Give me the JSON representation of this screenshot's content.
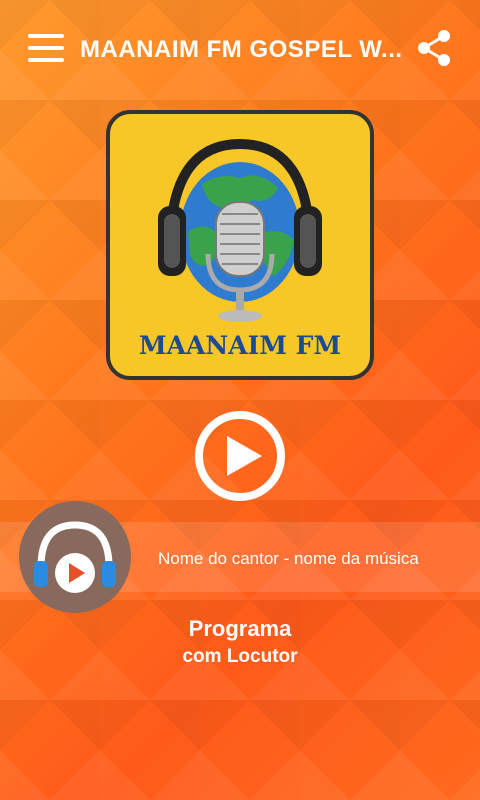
{
  "header": {
    "title": "MAANAIM FM GOSPEL W...",
    "menu_icon": "hamburger-menu-icon",
    "share_icon": "share-icon"
  },
  "logo": {
    "text": "MAANAIM FM",
    "colors": {
      "background": "#f7c627",
      "text": "#1c4a94",
      "border": "#333333"
    }
  },
  "player": {
    "play_icon": "play-icon",
    "track_info": "Nome do cantor - nome da música",
    "avatar_icon": "headphones-play-icon"
  },
  "program": {
    "name": "Programa",
    "host": "com Locutor"
  }
}
